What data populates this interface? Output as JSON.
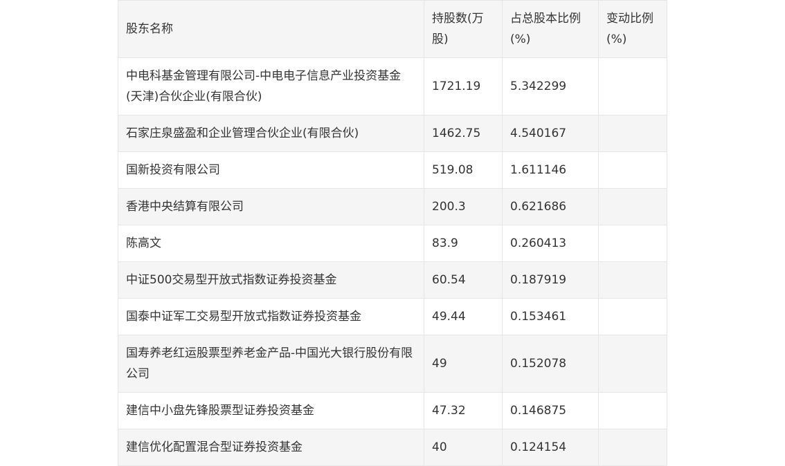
{
  "table": {
    "headers": [
      "股东名称",
      "持股数(万股)",
      "占总股本比例(%)",
      "变动比例(%)"
    ],
    "rows": [
      {
        "name": "中电科基金管理有限公司-中电电子信息产业投资基金(天津)合伙企业(有限合伙)",
        "shares": "1721.19",
        "ratio": "5.342299",
        "change": ""
      },
      {
        "name": "石家庄泉盛盈和企业管理合伙企业(有限合伙)",
        "shares": "1462.75",
        "ratio": "4.540167",
        "change": ""
      },
      {
        "name": "国新投资有限公司",
        "shares": "519.08",
        "ratio": "1.611146",
        "change": ""
      },
      {
        "name": "香港中央结算有限公司",
        "shares": "200.3",
        "ratio": "0.621686",
        "change": ""
      },
      {
        "name": "陈高文",
        "shares": "83.9",
        "ratio": "0.260413",
        "change": ""
      },
      {
        "name": "中证500交易型开放式指数证券投资基金",
        "shares": "60.54",
        "ratio": "0.187919",
        "change": ""
      },
      {
        "name": "国泰中证军工交易型开放式指数证券投资基金",
        "shares": "49.44",
        "ratio": "0.153461",
        "change": ""
      },
      {
        "name": "国寿养老红运股票型养老金产品-中国光大银行股份有限公司",
        "shares": "49",
        "ratio": "0.152078",
        "change": ""
      },
      {
        "name": "建信中小盘先锋股票型证券投资基金",
        "shares": "47.32",
        "ratio": "0.146875",
        "change": ""
      },
      {
        "name": "建信优化配置混合型证券投资基金",
        "shares": "40",
        "ratio": "0.124154",
        "change": ""
      }
    ]
  }
}
